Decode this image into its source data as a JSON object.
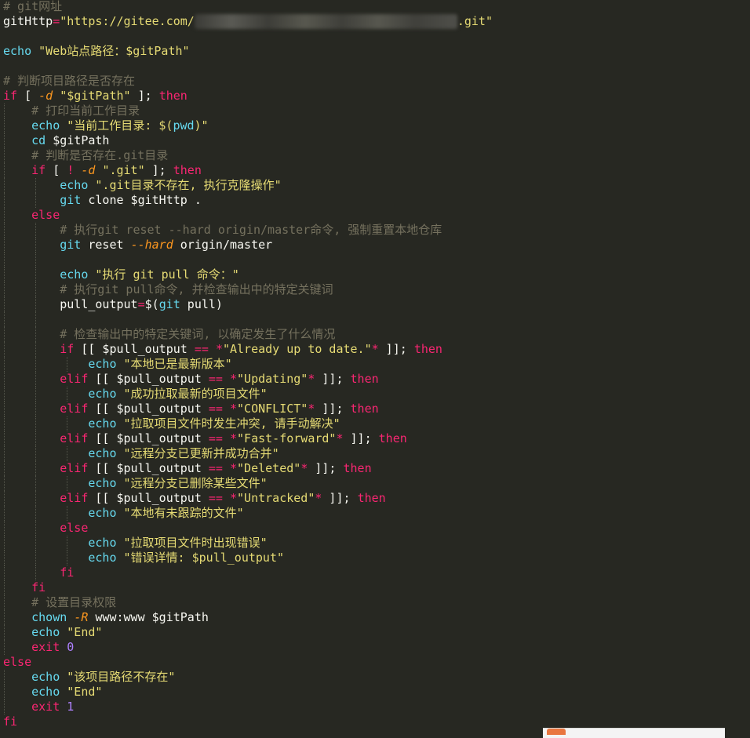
{
  "colors": {
    "background": "#272822",
    "comment": "#75715e",
    "keyword": "#f92672",
    "string": "#e6db74",
    "builtin": "#66d9ef",
    "plain": "#f8f8f2",
    "flag": "#fd971f",
    "number": "#ae81ff"
  },
  "code_lines": [
    {
      "indent": 0,
      "tokens": [
        {
          "t": "c",
          "v": "# git网址"
        }
      ]
    },
    {
      "indent": 0,
      "tokens": [
        {
          "t": "p",
          "v": "gitHttp"
        },
        {
          "t": "k",
          "v": "="
        },
        {
          "t": "s",
          "v": "\"https://gitee.com/"
        },
        {
          "t": "redacted",
          "v": ""
        },
        {
          "t": "s",
          "v": ".git\""
        }
      ]
    },
    {
      "indent": 0,
      "tokens": []
    },
    {
      "indent": 0,
      "tokens": [
        {
          "t": "f",
          "v": "echo"
        },
        {
          "t": "p",
          "v": " "
        },
        {
          "t": "s",
          "v": "\"Web站点路径：$gitPath\""
        }
      ]
    },
    {
      "indent": 0,
      "tokens": []
    },
    {
      "indent": 0,
      "tokens": [
        {
          "t": "c",
          "v": "# 判断项目路径是否存在"
        }
      ]
    },
    {
      "indent": 0,
      "tokens": [
        {
          "t": "k",
          "v": "if"
        },
        {
          "t": "p",
          "v": " [ "
        },
        {
          "t": "it",
          "v": "-d"
        },
        {
          "t": "p",
          "v": " "
        },
        {
          "t": "s",
          "v": "\"$gitPath\""
        },
        {
          "t": "p",
          "v": " ]; "
        },
        {
          "t": "k",
          "v": "then"
        }
      ]
    },
    {
      "indent": 1,
      "tokens": [
        {
          "t": "c",
          "v": "# 打印当前工作目录"
        }
      ]
    },
    {
      "indent": 1,
      "tokens": [
        {
          "t": "f",
          "v": "echo"
        },
        {
          "t": "p",
          "v": " "
        },
        {
          "t": "s",
          "v": "\"当前工作目录: $("
        },
        {
          "t": "f",
          "v": "pwd"
        },
        {
          "t": "s",
          "v": ")\""
        }
      ]
    },
    {
      "indent": 1,
      "tokens": [
        {
          "t": "f",
          "v": "cd"
        },
        {
          "t": "p",
          "v": " $gitPath"
        }
      ]
    },
    {
      "indent": 1,
      "tokens": [
        {
          "t": "c",
          "v": "# 判断是否存在.git目录"
        }
      ]
    },
    {
      "indent": 1,
      "tokens": [
        {
          "t": "k",
          "v": "if"
        },
        {
          "t": "p",
          "v": " [ "
        },
        {
          "t": "k",
          "v": "!"
        },
        {
          "t": "p",
          "v": " "
        },
        {
          "t": "it",
          "v": "-d"
        },
        {
          "t": "p",
          "v": " "
        },
        {
          "t": "s",
          "v": "\".git\""
        },
        {
          "t": "p",
          "v": " ]; "
        },
        {
          "t": "k",
          "v": "then"
        }
      ]
    },
    {
      "indent": 2,
      "tokens": [
        {
          "t": "f",
          "v": "echo"
        },
        {
          "t": "p",
          "v": " "
        },
        {
          "t": "s",
          "v": "\".git目录不存在, 执行克隆操作\""
        }
      ]
    },
    {
      "indent": 2,
      "tokens": [
        {
          "t": "f",
          "v": "git"
        },
        {
          "t": "p",
          "v": " clone $gitHttp ."
        }
      ]
    },
    {
      "indent": 1,
      "tokens": [
        {
          "t": "k",
          "v": "else"
        }
      ]
    },
    {
      "indent": 2,
      "tokens": [
        {
          "t": "c",
          "v": "# 执行git reset --hard origin/master命令, 强制重置本地仓库"
        }
      ]
    },
    {
      "indent": 2,
      "tokens": [
        {
          "t": "f",
          "v": "git"
        },
        {
          "t": "p",
          "v": " reset "
        },
        {
          "t": "it",
          "v": "--hard"
        },
        {
          "t": "p",
          "v": " origin/master"
        }
      ]
    },
    {
      "indent": 2,
      "tokens": []
    },
    {
      "indent": 2,
      "tokens": [
        {
          "t": "f",
          "v": "echo"
        },
        {
          "t": "p",
          "v": " "
        },
        {
          "t": "s",
          "v": "\"执行 git pull 命令：\""
        }
      ]
    },
    {
      "indent": 2,
      "tokens": [
        {
          "t": "c",
          "v": "# 执行git pull命令, 并检查输出中的特定关键词"
        }
      ]
    },
    {
      "indent": 2,
      "tokens": [
        {
          "t": "p",
          "v": "pull_output"
        },
        {
          "t": "k",
          "v": "="
        },
        {
          "t": "p",
          "v": "$("
        },
        {
          "t": "f",
          "v": "git"
        },
        {
          "t": "p",
          "v": " pull)"
        }
      ]
    },
    {
      "indent": 2,
      "tokens": []
    },
    {
      "indent": 2,
      "tokens": [
        {
          "t": "c",
          "v": "# 检查输出中的特定关键词, 以确定发生了什么情况"
        }
      ]
    },
    {
      "indent": 2,
      "tokens": [
        {
          "t": "k",
          "v": "if"
        },
        {
          "t": "p",
          "v": " [[ $pull_output "
        },
        {
          "t": "k",
          "v": "=="
        },
        {
          "t": "p",
          "v": " "
        },
        {
          "t": "k",
          "v": "*"
        },
        {
          "t": "s",
          "v": "\"Already up to date.\""
        },
        {
          "t": "k",
          "v": "*"
        },
        {
          "t": "p",
          "v": " ]]; "
        },
        {
          "t": "k",
          "v": "then"
        }
      ]
    },
    {
      "indent": 3,
      "tokens": [
        {
          "t": "f",
          "v": "echo"
        },
        {
          "t": "p",
          "v": " "
        },
        {
          "t": "s",
          "v": "\"本地已是最新版本\""
        }
      ]
    },
    {
      "indent": 2,
      "tokens": [
        {
          "t": "k",
          "v": "elif"
        },
        {
          "t": "p",
          "v": " [[ $pull_output "
        },
        {
          "t": "k",
          "v": "=="
        },
        {
          "t": "p",
          "v": " "
        },
        {
          "t": "k",
          "v": "*"
        },
        {
          "t": "s",
          "v": "\"Updating\""
        },
        {
          "t": "k",
          "v": "*"
        },
        {
          "t": "p",
          "v": " ]]; "
        },
        {
          "t": "k",
          "v": "then"
        }
      ]
    },
    {
      "indent": 3,
      "tokens": [
        {
          "t": "f",
          "v": "echo"
        },
        {
          "t": "p",
          "v": " "
        },
        {
          "t": "s",
          "v": "\"成功拉取最新的项目文件\""
        }
      ]
    },
    {
      "indent": 2,
      "tokens": [
        {
          "t": "k",
          "v": "elif"
        },
        {
          "t": "p",
          "v": " [[ $pull_output "
        },
        {
          "t": "k",
          "v": "=="
        },
        {
          "t": "p",
          "v": " "
        },
        {
          "t": "k",
          "v": "*"
        },
        {
          "t": "s",
          "v": "\"CONFLICT\""
        },
        {
          "t": "k",
          "v": "*"
        },
        {
          "t": "p",
          "v": " ]]; "
        },
        {
          "t": "k",
          "v": "then"
        }
      ]
    },
    {
      "indent": 3,
      "tokens": [
        {
          "t": "f",
          "v": "echo"
        },
        {
          "t": "p",
          "v": " "
        },
        {
          "t": "s",
          "v": "\"拉取项目文件时发生冲突, 请手动解决\""
        }
      ]
    },
    {
      "indent": 2,
      "tokens": [
        {
          "t": "k",
          "v": "elif"
        },
        {
          "t": "p",
          "v": " [[ $pull_output "
        },
        {
          "t": "k",
          "v": "=="
        },
        {
          "t": "p",
          "v": " "
        },
        {
          "t": "k",
          "v": "*"
        },
        {
          "t": "s",
          "v": "\"Fast-forward\""
        },
        {
          "t": "k",
          "v": "*"
        },
        {
          "t": "p",
          "v": " ]]; "
        },
        {
          "t": "k",
          "v": "then"
        }
      ]
    },
    {
      "indent": 3,
      "tokens": [
        {
          "t": "f",
          "v": "echo"
        },
        {
          "t": "p",
          "v": " "
        },
        {
          "t": "s",
          "v": "\"远程分支已更新并成功合并\""
        }
      ]
    },
    {
      "indent": 2,
      "tokens": [
        {
          "t": "k",
          "v": "elif"
        },
        {
          "t": "p",
          "v": " [[ $pull_output "
        },
        {
          "t": "k",
          "v": "=="
        },
        {
          "t": "p",
          "v": " "
        },
        {
          "t": "k",
          "v": "*"
        },
        {
          "t": "s",
          "v": "\"Deleted\""
        },
        {
          "t": "k",
          "v": "*"
        },
        {
          "t": "p",
          "v": " ]]; "
        },
        {
          "t": "k",
          "v": "then"
        }
      ]
    },
    {
      "indent": 3,
      "tokens": [
        {
          "t": "f",
          "v": "echo"
        },
        {
          "t": "p",
          "v": " "
        },
        {
          "t": "s",
          "v": "\"远程分支已删除某些文件\""
        }
      ]
    },
    {
      "indent": 2,
      "tokens": [
        {
          "t": "k",
          "v": "elif"
        },
        {
          "t": "p",
          "v": " [[ $pull_output "
        },
        {
          "t": "k",
          "v": "=="
        },
        {
          "t": "p",
          "v": " "
        },
        {
          "t": "k",
          "v": "*"
        },
        {
          "t": "s",
          "v": "\"Untracked\""
        },
        {
          "t": "k",
          "v": "*"
        },
        {
          "t": "p",
          "v": " ]]; "
        },
        {
          "t": "k",
          "v": "then"
        }
      ]
    },
    {
      "indent": 3,
      "tokens": [
        {
          "t": "f",
          "v": "echo"
        },
        {
          "t": "p",
          "v": " "
        },
        {
          "t": "s",
          "v": "\"本地有未跟踪的文件\""
        }
      ]
    },
    {
      "indent": 2,
      "tokens": [
        {
          "t": "k",
          "v": "else"
        }
      ]
    },
    {
      "indent": 3,
      "tokens": [
        {
          "t": "f",
          "v": "echo"
        },
        {
          "t": "p",
          "v": " "
        },
        {
          "t": "s",
          "v": "\"拉取项目文件时出现错误\""
        }
      ]
    },
    {
      "indent": 3,
      "tokens": [
        {
          "t": "f",
          "v": "echo"
        },
        {
          "t": "p",
          "v": " "
        },
        {
          "t": "s",
          "v": "\"错误详情: $pull_output\""
        }
      ]
    },
    {
      "indent": 2,
      "tokens": [
        {
          "t": "k",
          "v": "fi"
        }
      ]
    },
    {
      "indent": 1,
      "tokens": [
        {
          "t": "k",
          "v": "fi"
        }
      ]
    },
    {
      "indent": 1,
      "tokens": [
        {
          "t": "c",
          "v": "# 设置目录权限"
        }
      ]
    },
    {
      "indent": 1,
      "tokens": [
        {
          "t": "f",
          "v": "chown"
        },
        {
          "t": "p",
          "v": " "
        },
        {
          "t": "it",
          "v": "-R"
        },
        {
          "t": "p",
          "v": " www:www $gitPath"
        }
      ]
    },
    {
      "indent": 1,
      "tokens": [
        {
          "t": "f",
          "v": "echo"
        },
        {
          "t": "p",
          "v": " "
        },
        {
          "t": "s",
          "v": "\"End\""
        }
      ]
    },
    {
      "indent": 1,
      "tokens": [
        {
          "t": "k",
          "v": "exit"
        },
        {
          "t": "p",
          "v": " "
        },
        {
          "t": "n",
          "v": "0"
        }
      ]
    },
    {
      "indent": 0,
      "tokens": [
        {
          "t": "k",
          "v": "else"
        }
      ]
    },
    {
      "indent": 1,
      "tokens": [
        {
          "t": "f",
          "v": "echo"
        },
        {
          "t": "p",
          "v": " "
        },
        {
          "t": "s",
          "v": "\"该项目路径不存在\""
        }
      ]
    },
    {
      "indent": 1,
      "tokens": [
        {
          "t": "f",
          "v": "echo"
        },
        {
          "t": "p",
          "v": " "
        },
        {
          "t": "s",
          "v": "\"End\""
        }
      ]
    },
    {
      "indent": 1,
      "tokens": [
        {
          "t": "k",
          "v": "exit"
        },
        {
          "t": "p",
          "v": " "
        },
        {
          "t": "n",
          "v": "1"
        }
      ]
    },
    {
      "indent": 0,
      "tokens": [
        {
          "t": "k",
          "v": "fi"
        }
      ]
    }
  ]
}
